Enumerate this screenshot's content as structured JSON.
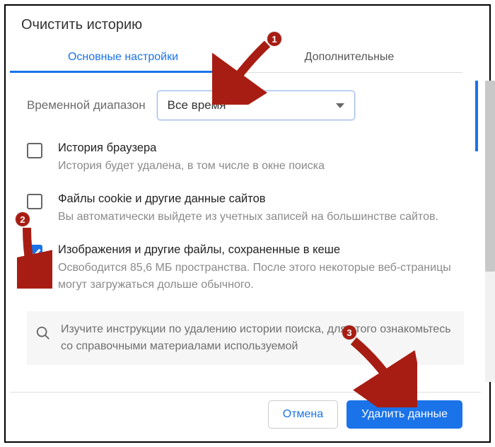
{
  "dialog": {
    "title": "Очистить историю",
    "tabs": {
      "basic": "Основные настройки",
      "advanced": "Дополнительные"
    },
    "time_range": {
      "label": "Временной диапазон",
      "value": "Все время"
    },
    "options": [
      {
        "title": "История браузера",
        "desc": "История будет удалена, в том числе в окне поиска",
        "checked": false
      },
      {
        "title": "Файлы cookie и другие данные сайтов",
        "desc": "Вы автоматически выйдете из учетных записей на большинстве сайтов.",
        "checked": false
      },
      {
        "title": "Изображения и другие файлы, сохраненные в кеше",
        "desc": "Освободится 85,6 МБ пространства. После этого некоторые веб-страницы могут загружаться дольше обычного.",
        "checked": true
      }
    ],
    "info": "Изучите инструкции по удалению истории поиска, для этого ознакомьтесь со справочными материалами используемой",
    "buttons": {
      "cancel": "Отмена",
      "confirm": "Удалить данные"
    }
  },
  "annotations": {
    "n1": "1",
    "n2": "2",
    "n3": "3"
  }
}
